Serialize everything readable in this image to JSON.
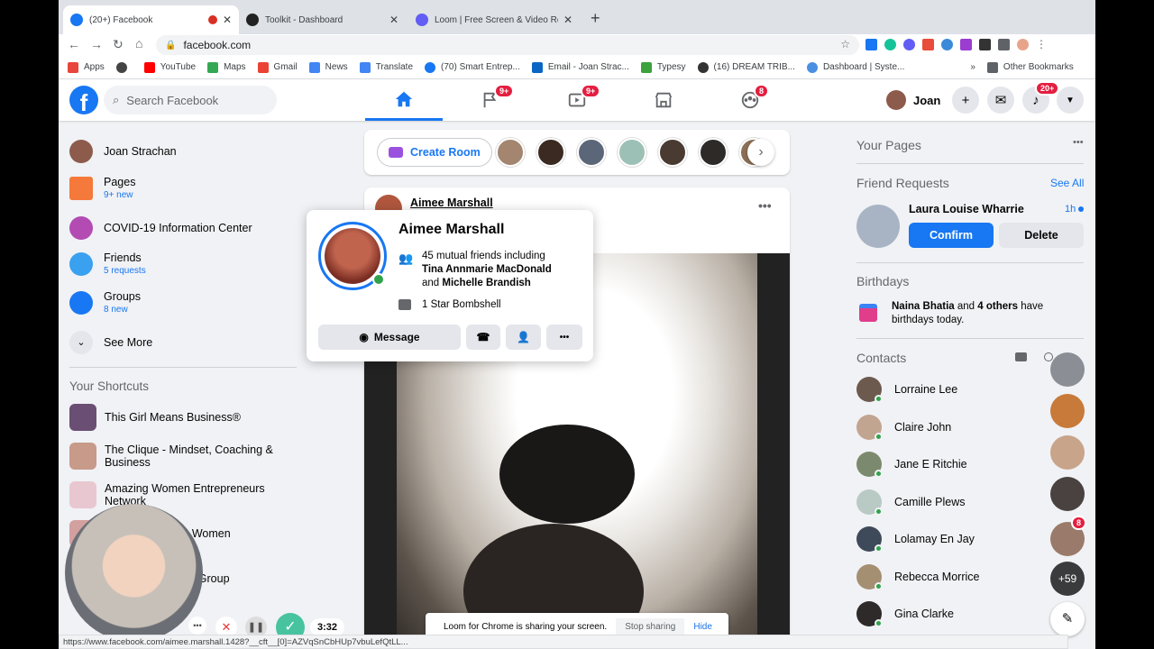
{
  "browser": {
    "tabs": [
      {
        "title": "(20+) Facebook",
        "active": true
      },
      {
        "title": "Toolkit - Dashboard",
        "active": false
      },
      {
        "title": "Loom | Free Screen & Video Re",
        "active": false
      }
    ],
    "new_tab": "+",
    "url": "facebook.com",
    "bookmarks": [
      "Apps",
      "",
      "YouTube",
      "Maps",
      "Gmail",
      "News",
      "Translate",
      "(70) Smart Entrep...",
      "Email - Joan Strac...",
      "Typesy",
      "(16) DREAM TRIB...",
      "Dashboard | Syste...",
      "»",
      "Other Bookmarks"
    ],
    "status_url": "https://www.facebook.com/aimee.marshall.1428?__cft__[0]=AZVqSnCbHUp7vbuLefQtLL..."
  },
  "fb": {
    "search_placeholder": "Search Facebook",
    "nav_badges": {
      "pages": "9+",
      "watch": "9+",
      "groups": "8"
    },
    "profile_name": "Joan",
    "notif_badge": "20+",
    "left": {
      "user": "Joan Strachan",
      "pages": "Pages",
      "pages_sub": "9+ new",
      "covid": "COVID-19 Information Center",
      "friends": "Friends",
      "friends_sub": "5 requests",
      "groups": "Groups",
      "groups_sub": "8 new",
      "see_more": "See More",
      "shortcuts_title": "Your Shortcuts",
      "shortcuts": [
        "This Girl Means Business®",
        "The Clique - Mindset, Coaching & Business",
        "Amazing Women Entrepreneurs Network",
        "elping Women",
        "cotland Group"
      ]
    },
    "center": {
      "create_room": "Create Room",
      "post_author": "Aimee Marshall"
    },
    "hover": {
      "name": "Aimee Marshall",
      "mutual_pre": "45 mutual friends including",
      "mutual_1": "Tina Annmarie MacDonald",
      "mutual_and": "and",
      "mutual_2": "Michelle Brandish",
      "work": "1 Star Bombshell",
      "message": "Message"
    },
    "right": {
      "your_pages": "Your Pages",
      "friend_requests": "Friend Requests",
      "see_all": "See All",
      "req_name": "Laura Louise Wharrie",
      "req_time": "1h",
      "confirm": "Confirm",
      "delete": "Delete",
      "birthdays": "Birthdays",
      "bday_name": "Naina Bhatia",
      "bday_mid": " and ",
      "bday_others": "4 others",
      "bday_tail": " have birthdays today.",
      "contacts": "Contacts",
      "contact_list": [
        "Lorraine Lee",
        "Claire John",
        "Jane E Ritchie",
        "Camille Plews",
        "Lolamay En Jay",
        "Rebecca Morrice",
        "Gina Clarke"
      ],
      "bubble_badge": "8",
      "more_count": "+59"
    }
  },
  "loom": {
    "timer": "3:32",
    "sharing": "Loom for Chrome is sharing your screen.",
    "stop": "Stop sharing",
    "hide": "Hide"
  },
  "colors": {
    "fb_blue": "#1877f2",
    "badge_red": "#e41e3f",
    "online": "#31a24c",
    "bg": "#f0f2f5"
  }
}
